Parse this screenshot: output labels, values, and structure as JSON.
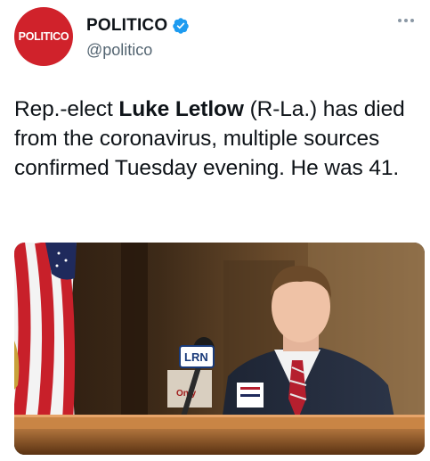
{
  "account": {
    "avatar_text": "POLITICO",
    "display_name": "POLITICO",
    "handle": "@politico",
    "brand_color": "#d0222b",
    "verified_color": "#1d9bf0"
  },
  "tweet": {
    "text_before": "Rep.-elect ",
    "text_bold": "Luke Letlow",
    "text_after": " (R-La.) has died from the coronavirus, multiple sources confirmed Tuesday evening. He was 41."
  },
  "media": {
    "mic_flag_text": "LRN",
    "sign_text_1": "Only",
    "icons": [
      "american-flag",
      "microphone",
      "podium"
    ]
  },
  "icons": {
    "verified": "verified-badge-icon",
    "more": "more-options-icon"
  }
}
